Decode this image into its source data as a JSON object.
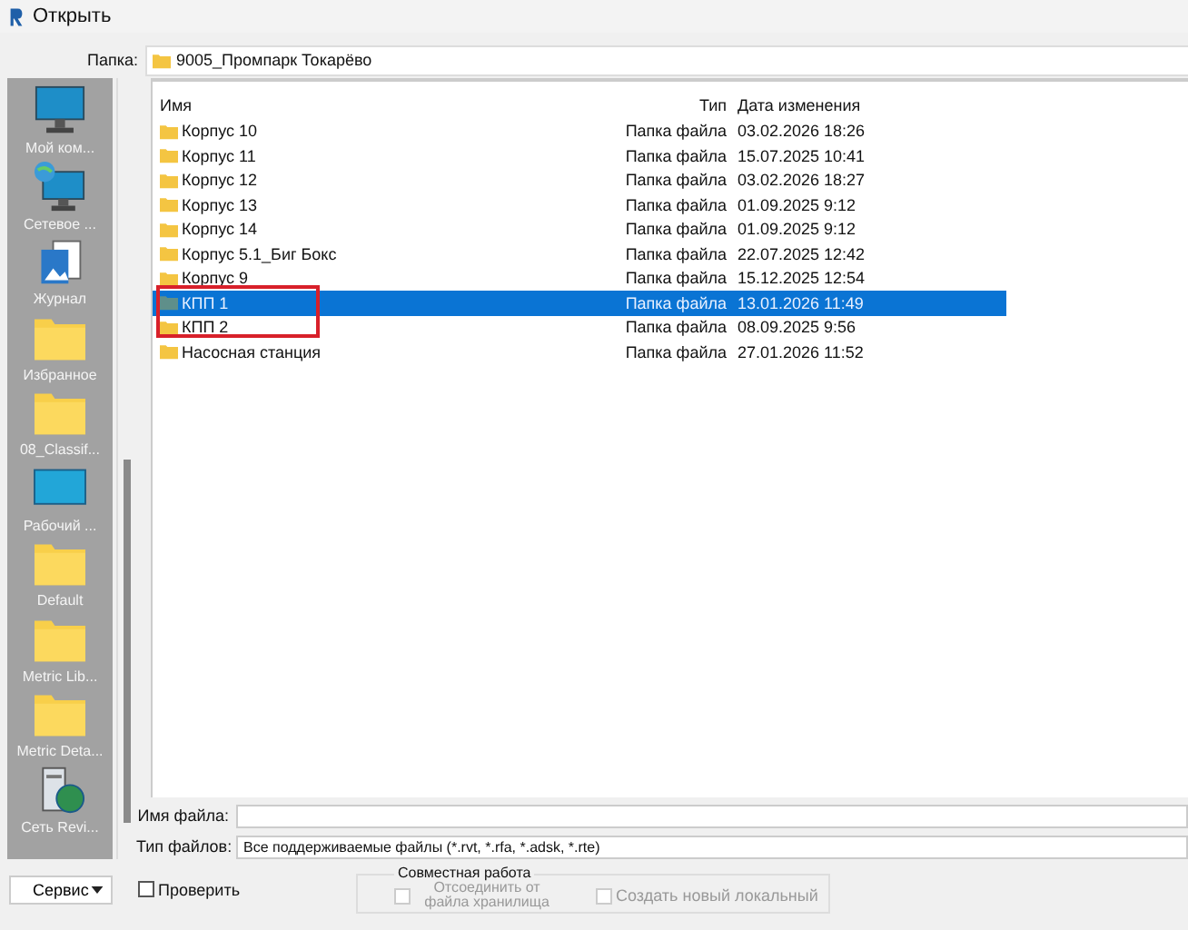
{
  "window": {
    "title": "Открыть"
  },
  "folder": {
    "label": "Папка:",
    "value": "9005_Промпарк Токарёво"
  },
  "places": [
    {
      "label": "Мой ком...",
      "kind": "computer"
    },
    {
      "label": "Сетевое ...",
      "kind": "network"
    },
    {
      "label": "Журнал",
      "kind": "journal"
    },
    {
      "label": "Избранное",
      "kind": "folder"
    },
    {
      "label": "08_Classif...",
      "kind": "folder"
    },
    {
      "label": "Рабочий ...",
      "kind": "desktop"
    },
    {
      "label": "Default",
      "kind": "folder"
    },
    {
      "label": "Metric Lib...",
      "kind": "folder"
    },
    {
      "label": "Metric Deta...",
      "kind": "folder"
    },
    {
      "label": "Сеть Revi...",
      "kind": "server"
    }
  ],
  "table": {
    "columns": [
      "Имя",
      "Тип",
      "Дата изменения"
    ],
    "rows": [
      {
        "name": "Корпус 10",
        "type": "Папка файла",
        "date": "03.02.2026 18:26",
        "selected": false
      },
      {
        "name": "Корпус 11",
        "type": "Папка файла",
        "date": "15.07.2025 10:41",
        "selected": false
      },
      {
        "name": "Корпус 12",
        "type": "Папка файла",
        "date": "03.02.2026 18:27",
        "selected": false
      },
      {
        "name": "Корпус 13",
        "type": "Папка файла",
        "date": "01.09.2025 9:12",
        "selected": false
      },
      {
        "name": "Корпус 14",
        "type": "Папка файла",
        "date": "01.09.2025 9:12",
        "selected": false
      },
      {
        "name": "Корпус 5.1_Биг Бокс",
        "type": "Папка файла",
        "date": "22.07.2025 12:42",
        "selected": false
      },
      {
        "name": "Корпус 9",
        "type": "Папка файла",
        "date": "15.12.2025 12:54",
        "selected": false
      },
      {
        "name": "КПП 1",
        "type": "Папка файла",
        "date": "13.01.2026 11:49",
        "selected": true
      },
      {
        "name": "КПП 2",
        "type": "Папка файла",
        "date": "08.09.2025 9:56",
        "selected": false
      },
      {
        "name": "Насосная станция",
        "type": "Папка файла",
        "date": "27.01.2026 11:52",
        "selected": false
      }
    ]
  },
  "file_name": {
    "label": "Имя файла:"
  },
  "file_type": {
    "label": "Тип файлов:",
    "value": "Все поддерживаемые файлы  (*.rvt, *.rfa, *.adsk, *.rte)"
  },
  "service_button": {
    "label": "Сервис"
  },
  "verify": {
    "label": "Проверить",
    "checked": false,
    "disabled": false
  },
  "collaboration": {
    "title": "Совместная работа",
    "options": [
      {
        "label": "Отсоединить от файла хранилища",
        "checked": false,
        "disabled": true
      },
      {
        "label": "Создать новый локальный",
        "checked": false,
        "disabled": true
      }
    ]
  }
}
